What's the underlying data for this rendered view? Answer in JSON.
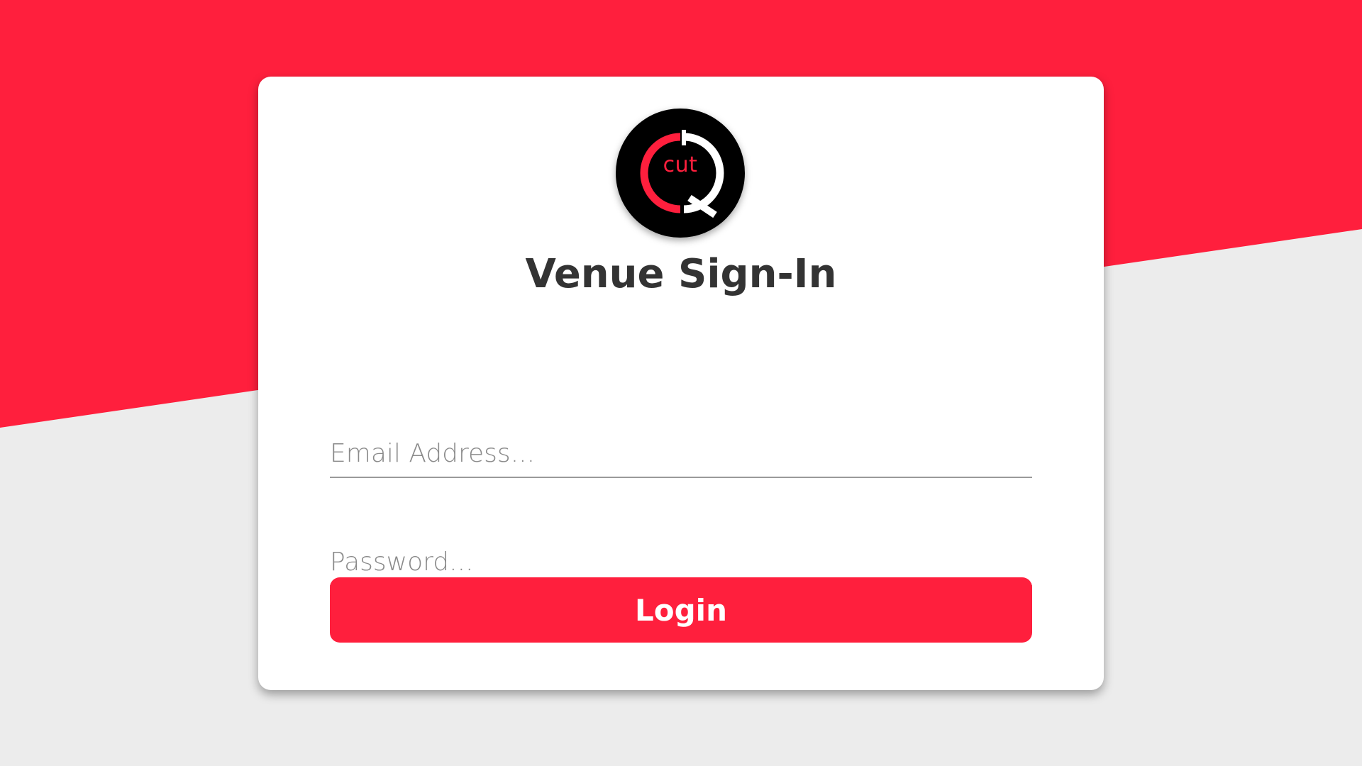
{
  "brand": {
    "logo_text": "cut",
    "logo_icon": "cutq-logo-icon",
    "colors": {
      "accent": "#ff1f3d",
      "logo_background": "#000000",
      "page_background": "#ececec",
      "card_background": "#ffffff",
      "title_text": "#333333"
    }
  },
  "form": {
    "title": "Venue Sign-In",
    "email": {
      "placeholder": "Email Address...",
      "value": ""
    },
    "password": {
      "placeholder": "Password...",
      "value": ""
    },
    "login_label": "Login"
  }
}
